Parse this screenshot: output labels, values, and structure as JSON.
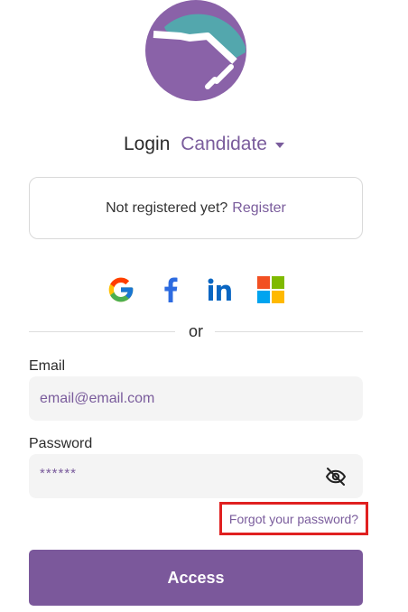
{
  "header": {
    "logo_icon": "handshake-logo-icon",
    "login_label": "Login",
    "role_selected": "Candidate"
  },
  "register": {
    "prompt": "Not registered yet?",
    "link_label": "Register"
  },
  "social": [
    {
      "name": "Google",
      "icon": "google-icon"
    },
    {
      "name": "Facebook",
      "icon": "facebook-icon"
    },
    {
      "name": "LinkedIn",
      "icon": "linkedin-icon"
    },
    {
      "name": "Microsoft",
      "icon": "microsoft-icon"
    }
  ],
  "divider": {
    "text": "or"
  },
  "form": {
    "email_label": "Email",
    "email_placeholder": "email@email.com",
    "password_label": "Password",
    "password_value": "******",
    "forgot_label": "Forgot your password?",
    "submit_label": "Access"
  },
  "colors": {
    "brand_purple": "#7b589b",
    "brand_teal": "#4fa6ab",
    "highlight_red": "#e02020"
  }
}
